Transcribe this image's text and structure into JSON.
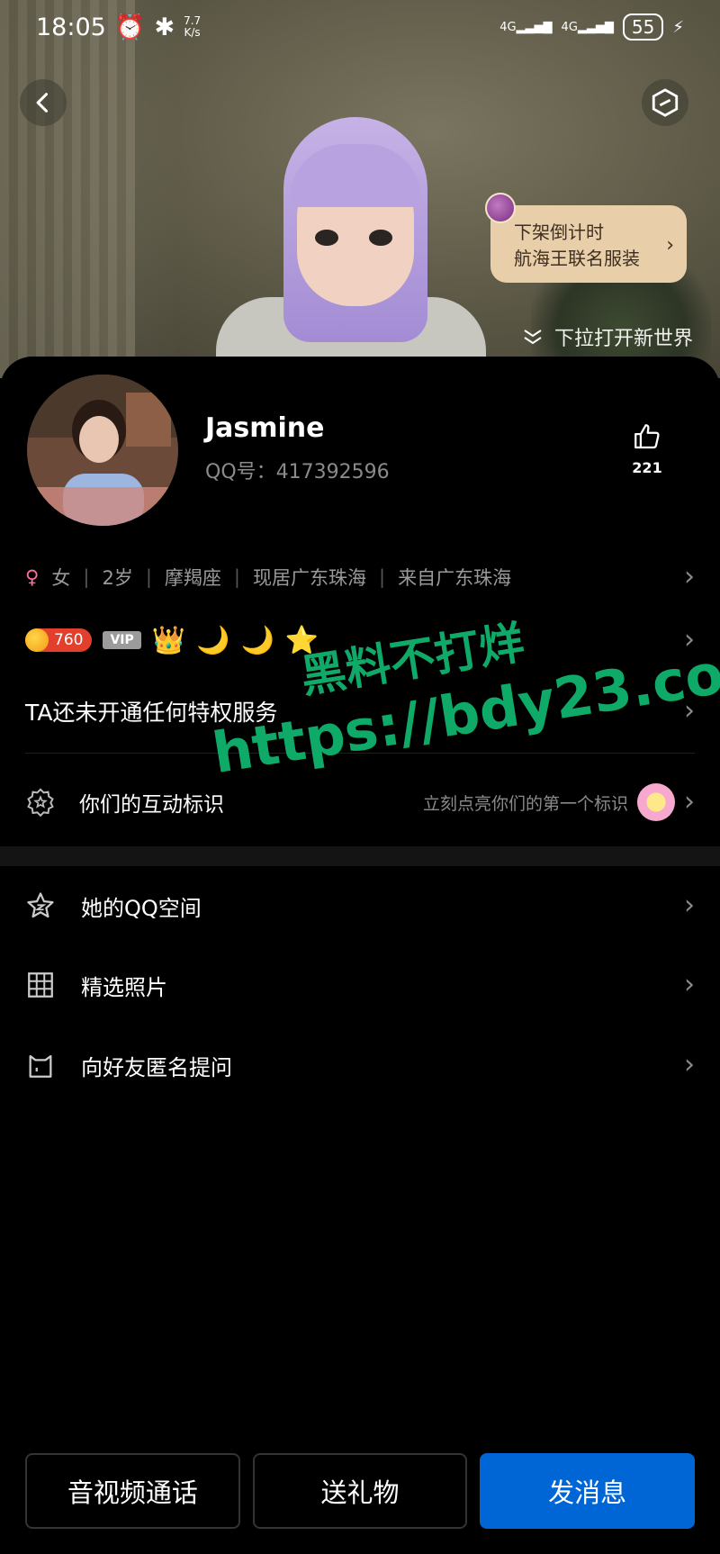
{
  "status_bar": {
    "time": "18:05",
    "net_speed_value": "7.7",
    "net_speed_unit": "K/s",
    "signal1_label": "4G",
    "signal2_label": "4G",
    "battery": "55"
  },
  "hero": {
    "promo_line1": "下架倒计时",
    "promo_line2": "航海王联名服装",
    "pull_hint": "下拉打开新世界"
  },
  "profile": {
    "name": "Jasmine",
    "qq_label": "QQ号：",
    "qq_number": "417392596",
    "likes": "221",
    "gender_symbol": "♀",
    "gender": "女",
    "age": "2岁",
    "zodiac": "摩羯座",
    "current_city": "现居广东珠海",
    "hometown": "来自广东珠海"
  },
  "badges": {
    "coin_level": "760",
    "vip_label": "VIP",
    "icons": [
      "crown-icon",
      "moon-icon",
      "moon-icon",
      "star-icon"
    ]
  },
  "privilege": {
    "text": "TA还未开通任何特权服务"
  },
  "interaction": {
    "label": "你们的互动标识",
    "hint": "立刻点亮你们的第一个标识"
  },
  "menu": [
    {
      "label": "她的QQ空间",
      "icon": "qzone-star-icon"
    },
    {
      "label": "精选照片",
      "icon": "photo-grid-icon"
    },
    {
      "label": "向好友匿名提问",
      "icon": "anonymous-question-icon"
    }
  ],
  "actions": {
    "call": "音视频通话",
    "gift": "送礼物",
    "message": "发消息"
  },
  "watermark": {
    "line1": "黑料不打烊",
    "line2": "https://bdy23.co"
  },
  "colors": {
    "primary_button": "#0066d6",
    "coin_badge": "#e2402c",
    "promo_bg": "#e8cfa9",
    "watermark": "#0fa968"
  }
}
